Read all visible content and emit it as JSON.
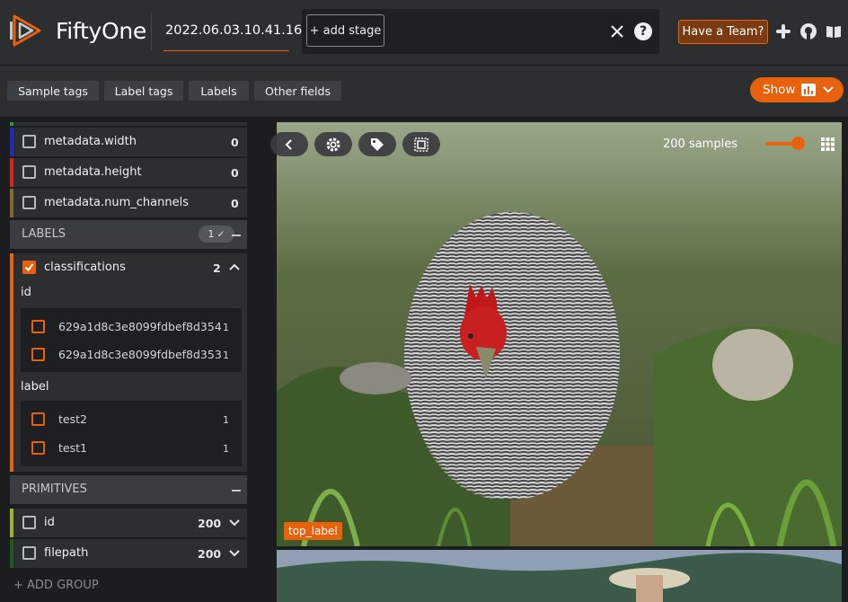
{
  "app": {
    "name": "FiftyOne",
    "dataset": "2022.06.03.10.41.16"
  },
  "header": {
    "add_stage_label": "+ add stage",
    "clear_icon": "close-icon",
    "help_label": "?",
    "team_button": "Have a Team?",
    "icons": [
      "slack-icon",
      "github-icon",
      "docs-book-icon"
    ]
  },
  "toolbar": {
    "tabs": [
      "Sample tags",
      "Label tags",
      "Labels",
      "Other fields"
    ],
    "show_label": "Show"
  },
  "sidebar": {
    "metadata_rows": [
      {
        "label": "metadata.width",
        "count": "0",
        "color": "#1d2cc8"
      },
      {
        "label": "metadata.height",
        "count": "0",
        "color": "#d7261e"
      },
      {
        "label": "metadata.num_channels",
        "count": "0",
        "color": "#8a6a2a"
      }
    ],
    "labels_group": {
      "title": "LABELS",
      "badge": "1 ✓"
    },
    "classifications": {
      "label": "classifications",
      "count": "2",
      "color": "#e8620e",
      "id_title": "id",
      "ids": [
        {
          "value": "629a1d8c3e8099fdbef8d354",
          "count": "1"
        },
        {
          "value": "629a1d8c3e8099fdbef8d353",
          "count": "1"
        }
      ],
      "label_title": "label",
      "labels": [
        {
          "value": "test2",
          "count": "1"
        },
        {
          "value": "test1",
          "count": "1"
        }
      ]
    },
    "primitives_group": {
      "title": "PRIMITIVES"
    },
    "primitive_rows": [
      {
        "label": "id",
        "count": "200",
        "color": "#9bb52a"
      },
      {
        "label": "filepath",
        "count": "200",
        "color": "#1f5a1f"
      }
    ],
    "add_group_label": "+ ADD GROUP"
  },
  "grid": {
    "samples_text": "200 samples",
    "top_label": "top_label",
    "controls": [
      "back-icon",
      "settings-gear-icon",
      "tag-icon",
      "select-icon"
    ],
    "zoom_level": 0.85
  },
  "colors": {
    "accent": "#e8620e",
    "bg": "#1b1d1f",
    "panel": "#2c2e30"
  }
}
